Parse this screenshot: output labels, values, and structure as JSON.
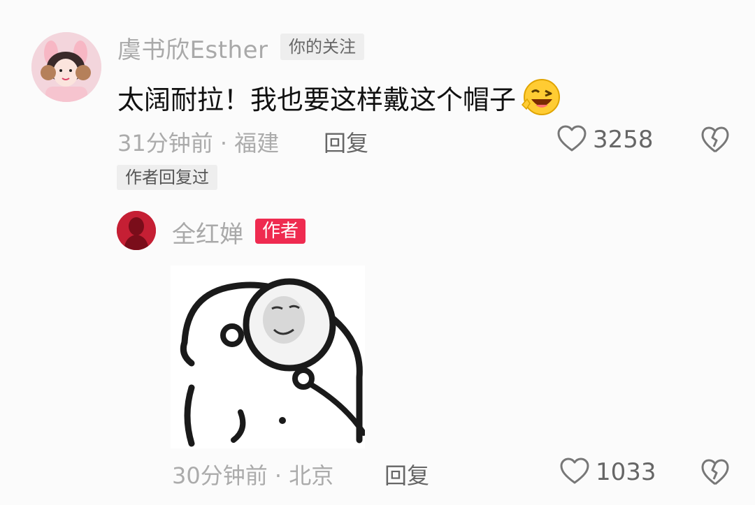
{
  "comment": {
    "username": "虞书欣Esther",
    "follow_tag": "你的关注",
    "text": "太阔耐拉！我也要这样戴这个帽子",
    "emoji": "wink-emoji",
    "time_location": "31分钟前 · 福建",
    "reply_label": "回复",
    "like_count": "3258",
    "author_replied_tag": "作者回复过"
  },
  "reply": {
    "username": "全红婵",
    "author_tag": "作者",
    "sticker": "sleeping-panda-meme-sticker",
    "time_location": "30分钟前 · 北京",
    "reply_label": "回复",
    "like_count": "1033"
  },
  "icons": {
    "like": "heart-outline-icon",
    "dislike": "broken-heart-icon"
  },
  "colors": {
    "author_tag": "#ef2b50",
    "muted_text": "#ababab",
    "tag_bg": "#eeeeee"
  }
}
